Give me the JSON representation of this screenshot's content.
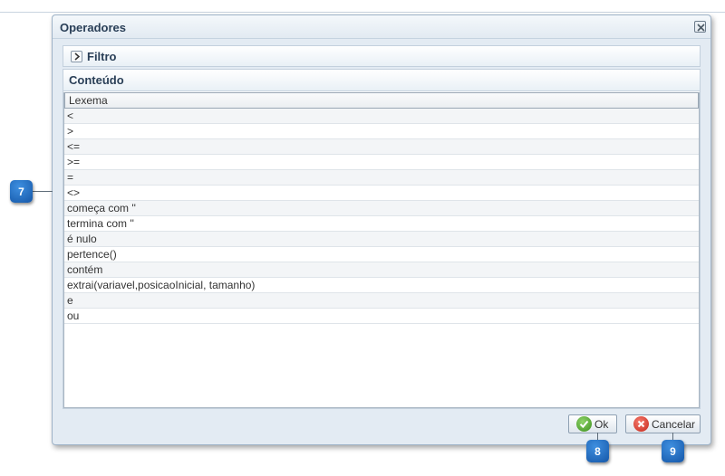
{
  "dialog": {
    "title": "Operadores",
    "filter_label": "Filtro",
    "content_label": "Conteúdo"
  },
  "table": {
    "header": "Lexema",
    "rows": [
      "<",
      ">",
      "<=",
      ">=",
      "=",
      "<>",
      "começa com ''",
      "termina com ''",
      "é nulo",
      "pertence()",
      "contém",
      "extrai(variavel,posicaoInicial, tamanho)",
      "e",
      "ou"
    ]
  },
  "buttons": {
    "ok_label": "Ok",
    "cancel_label": "Cancelar",
    "ok_icon": "check-icon",
    "cancel_icon": "x-icon"
  },
  "callouts": [
    "7",
    "8",
    "9"
  ],
  "colors": {
    "callout": "#1f6fc8",
    "title": "#2a3f57",
    "ok_green": "#3b8f1c",
    "cancel_red": "#c4261a"
  }
}
